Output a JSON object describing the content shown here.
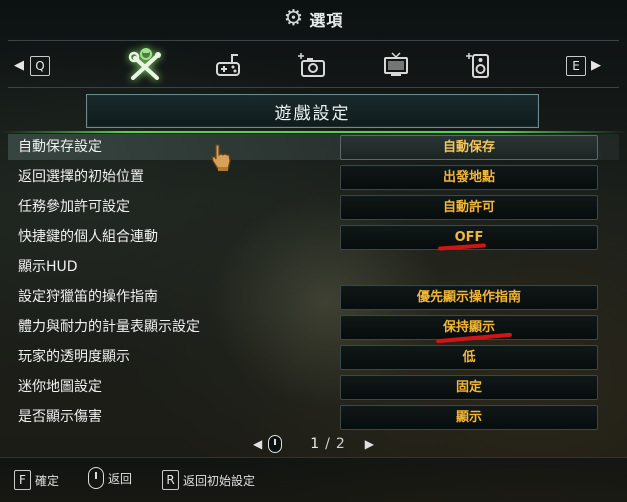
{
  "header": {
    "gear_icon": "gear-icon",
    "title": "選項"
  },
  "tabs": {
    "prev_key": "Q",
    "next_key": "E",
    "prev_arrow": "◀",
    "next_arrow": "▶",
    "items": [
      {
        "icon": "game-settings-icon",
        "active": true
      },
      {
        "icon": "controller-icon",
        "active": false
      },
      {
        "icon": "camera-icon",
        "active": false
      },
      {
        "icon": "display-icon",
        "active": false
      },
      {
        "icon": "speaker-icon",
        "active": false
      }
    ]
  },
  "section": {
    "title": "遊戲設定"
  },
  "settings": [
    {
      "label": "自動保存設定",
      "value": "自動保存"
    },
    {
      "label": "返回選擇的初始位置",
      "value": "出發地點"
    },
    {
      "label": "任務參加許可設定",
      "value": "自動許可"
    },
    {
      "label": "快捷鍵的個人組合連動",
      "value": "OFF"
    },
    {
      "label": "顯示HUD",
      "value": ""
    },
    {
      "label": "設定狩獵笛的操作指南",
      "value": "優先顯示操作指南"
    },
    {
      "label": "體力與耐力的計量表顯示設定",
      "value": "保持顯示"
    },
    {
      "label": "玩家的透明度顯示",
      "value": "低"
    },
    {
      "label": "迷你地圖設定",
      "value": "固定"
    },
    {
      "label": "是否顯示傷害",
      "value": "顯示"
    }
  ],
  "pager": {
    "left_arrow": "◀",
    "right_arrow": "▶",
    "current": "1",
    "separator": "/",
    "total": "2"
  },
  "footer": {
    "confirm_key": "F",
    "confirm_label": "確定",
    "back_label": "返回",
    "reset_key": "R",
    "reset_label": "返回初始設定"
  },
  "colors": {
    "value_text": "#f2b638",
    "accent_green": "#5ae650",
    "annotation_red": "#d21414"
  }
}
